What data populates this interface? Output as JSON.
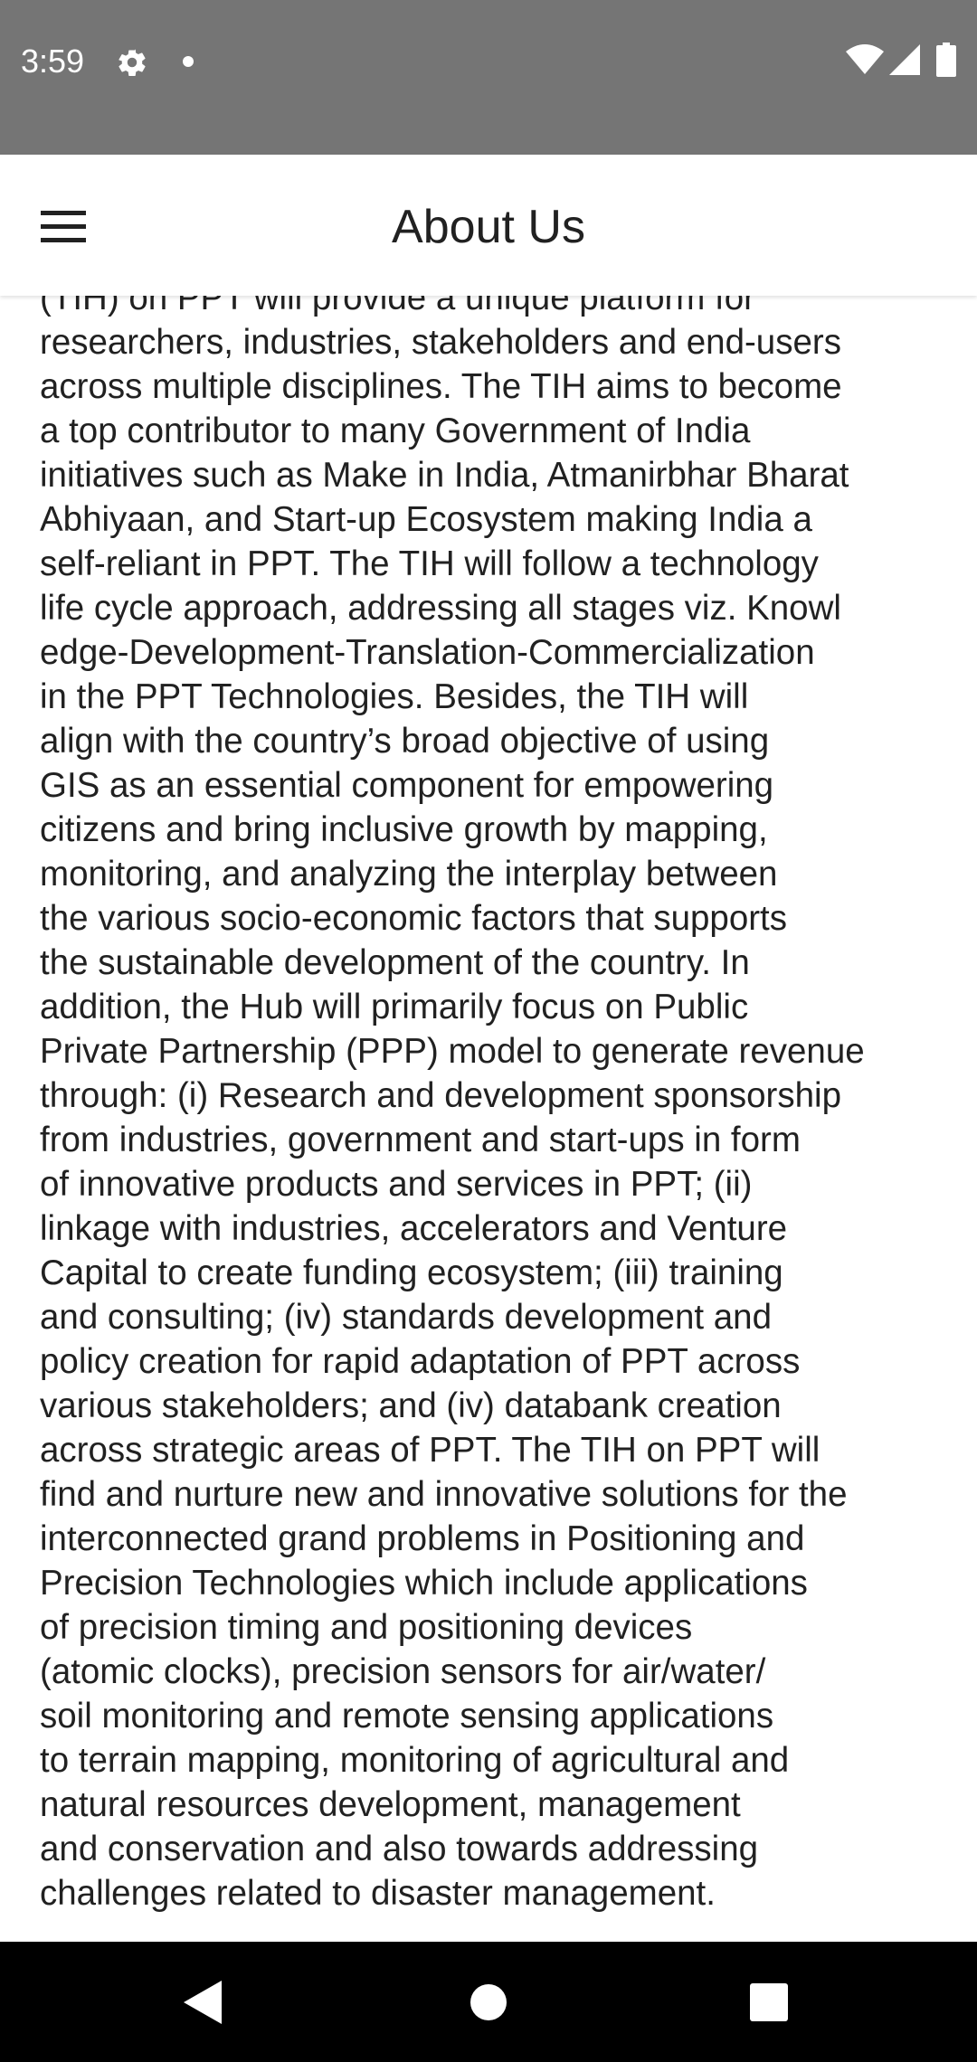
{
  "status_bar": {
    "time": "3:59",
    "icons": [
      "settings-icon",
      "notification-dot-icon",
      "wifi-icon",
      "cellular-signal-icon",
      "battery-icon"
    ],
    "background": "#757575"
  },
  "app_bar": {
    "title": "About Us",
    "menu_icon": "hamburger-menu-icon"
  },
  "content": {
    "lines": [
      "(TIH) on PPT will provide a unique platform for",
      "researchers, industries, stakeholders and end-users",
      "across multiple disciplines. The TIH aims to become",
      "a top contributor to many Government of India",
      "initiatives such as Make in India, Atmanirbhar Bharat",
      "Abhiyaan, and Start-up Ecosystem making India a",
      "self-reliant in PPT. The TIH will follow a technology",
      "life cycle approach, addressing all stages viz. Knowl",
      "edge-Development-Translation-Commercialization",
      "in the PPT Technologies. Besides, the TIH will",
      "align with the country’s broad objective of using",
      "GIS as an essential component for empowering",
      "citizens and bring inclusive growth by mapping,",
      "monitoring, and analyzing the interplay between",
      "the various socio-economic factors that supports",
      "the sustainable development of the country. In",
      "addition, the Hub will primarily focus on Public",
      "Private Partnership (PPP) model to generate revenue",
      "through: (i) Research and development sponsorship",
      "from industries, government and start-ups in form",
      "of innovative products and services in PPT; (ii)",
      "linkage with industries, accelerators and Venture",
      "Capital to create funding ecosystem; (iii) training",
      "and consulting; (iv) standards development and",
      "policy creation for rapid adaptation of PPT across",
      "various stakeholders; and (iv) databank creation",
      "across strategic areas of PPT. The TIH on PPT will",
      "find and nurture new and innovative solutions for the",
      "interconnected grand problems in Positioning and",
      "Precision Technologies which include applications",
      "of precision timing and positioning devices",
      "(atomic clocks), precision sensors for air/water/",
      "soil monitoring and remote sensing applications",
      "to terrain mapping, monitoring of agricultural and",
      "natural resources development, management",
      "and conservation and also towards addressing",
      "challenges related to disaster management."
    ]
  },
  "nav_bar": {
    "buttons": [
      "back-icon",
      "home-icon",
      "recents-icon"
    ],
    "background": "#000000"
  }
}
